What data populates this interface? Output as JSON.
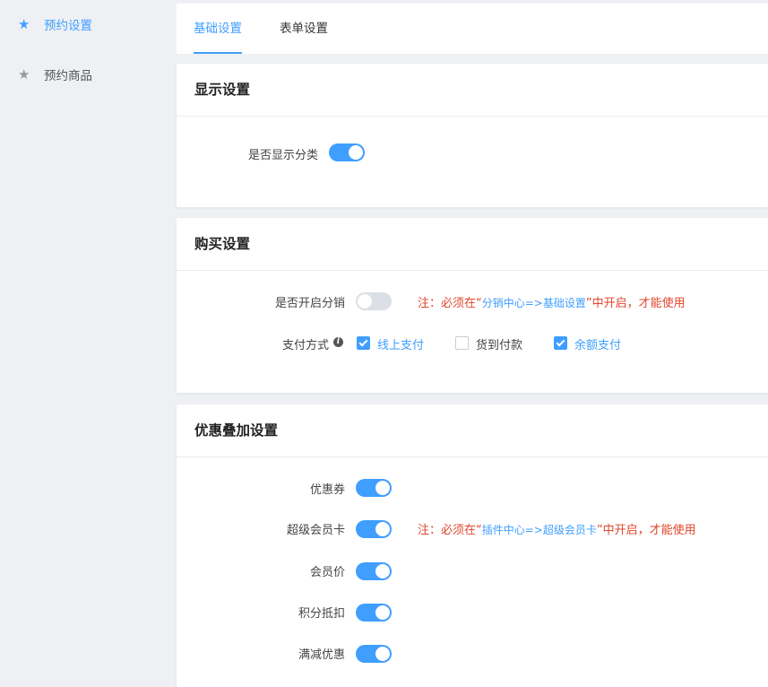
{
  "sidebar": {
    "items": [
      {
        "label": "预约设置",
        "icon": "star-icon",
        "active": true
      },
      {
        "label": "预约商品",
        "icon": "star-icon",
        "active": false
      }
    ]
  },
  "tabs": [
    {
      "label": "基础设置",
      "active": true
    },
    {
      "label": "表单设置",
      "active": false
    }
  ],
  "display": {
    "title": "显示设置",
    "show_category_label": "是否显示分类",
    "show_category_on": true
  },
  "purchase": {
    "title": "购买设置",
    "distribution_label": "是否开启分销",
    "distribution_on": false,
    "distribution_note_prefix": "注：必须在“",
    "distribution_note_link": "分销中心=>基础设置",
    "distribution_note_suffix": "”中开启，才能使用",
    "payment_label": "支付方式",
    "payment_options": [
      {
        "label": "线上支付",
        "checked": true
      },
      {
        "label": "货到付款",
        "checked": false
      },
      {
        "label": "余额支付",
        "checked": true
      }
    ]
  },
  "discount": {
    "title": "优惠叠加设置",
    "items": [
      {
        "label": "优惠券",
        "on": true
      },
      {
        "label": "超级会员卡",
        "on": true
      },
      {
        "label": "会员价",
        "on": true
      },
      {
        "label": "积分抵扣",
        "on": true
      },
      {
        "label": "满减优惠",
        "on": true
      }
    ],
    "vip_note_prefix": "注：必须在“",
    "vip_note_link": "插件中心=>超级会员卡",
    "vip_note_suffix": "”中开启，才能使用"
  },
  "colors": {
    "accent": "#409eff",
    "warning_text": "#e0452b",
    "switch_off": "#dcdfe6"
  }
}
